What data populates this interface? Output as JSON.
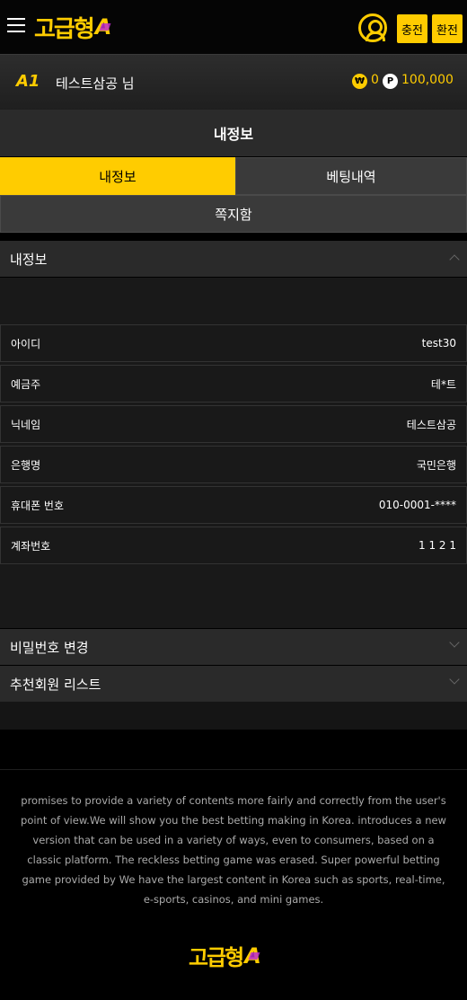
{
  "header": {
    "logo_text": "고급형",
    "logo_suffix": "A",
    "deposit_label": "충전",
    "withdraw_label": "환전"
  },
  "user": {
    "badge": "A1",
    "name": "테스트삼공 님",
    "won_symbol": "₩",
    "won_balance": "0",
    "point_symbol": "P",
    "point_balance": "100,000"
  },
  "page": {
    "title": "내정보",
    "tabs": [
      {
        "label": "내정보",
        "active": true
      },
      {
        "label": "베팅내역",
        "active": false
      },
      {
        "label": "쪽지함",
        "active": false
      }
    ]
  },
  "accordion": {
    "my_info": {
      "title": "내정보",
      "rows": [
        {
          "label": "아이디",
          "value": "test30"
        },
        {
          "label": "예금주",
          "value": "테*트"
        },
        {
          "label": "닉네임",
          "value": "테스트삼공"
        },
        {
          "label": "은행명",
          "value": "국민은행"
        },
        {
          "label": "휴대폰 번호",
          "value": "010-0001-****"
        },
        {
          "label": "계좌번호",
          "value": "1 1 2 1"
        }
      ]
    },
    "password_change": {
      "title": "비밀번호 변경"
    },
    "referral_list": {
      "title": "추천회원 리스트"
    }
  },
  "footer": {
    "description": "promises to provide a variety of contents more fairly and correctly from the user's point of view.We will show you the best betting making in Korea. introduces a new version that can be used in a variety  of ways, even to consumers, based on a classic platform. The reckless betting game was erased. Super powerful betting game provided by  We have the largest content in Korea such as sports, real-time, e-sports, casinos, and mini games.",
    "logo_text": "고급형",
    "logo_suffix": "A"
  },
  "colors": {
    "accent": "#ffcc00",
    "background": "#000000",
    "panel": "#191919"
  }
}
